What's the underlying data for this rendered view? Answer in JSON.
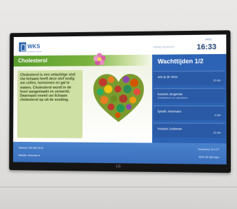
{
  "header": {
    "logo": "WKS",
    "logo_sub": "medische centra",
    "date": "vrijdag 28 januari",
    "brand": "ePOC",
    "time": "16:33"
  },
  "article": {
    "title": "Cholesterol",
    "text": "Cholesterol is een vetachtige stof. Uw lichaam heeft deze stof nodig om cellen, hormonen en gal te maken. Cholesterol wordt in de lever aangemaakt en verwerkt. Daarnaast neemt uw lichaam cholesterol op uit de voeding."
  },
  "waiting": {
    "title": "Wachttijden 1/2",
    "rows": [
      {
        "name": "arts ip de Vries",
        "sub": "",
        "time": "10 min"
      },
      {
        "name": "huisarts Jongsmas",
        "sub": "Cholesterol u.vt. spreekuur",
        "time": ""
      },
      {
        "name": "fysioth. Kleemans",
        "sub": "",
        "time": "0 min"
      },
      {
        "name": "huisarts Lindsman",
        "sub": "",
        "time": "10 min"
      }
    ]
  },
  "footer": {
    "phone": "Telefoon: 024 350 03 04",
    "website": "Website: www.wks.nl",
    "address": "Hertekamp 16-13 P",
    "city": "6525 SB Nijmegen"
  },
  "tv_brand": "LG"
}
